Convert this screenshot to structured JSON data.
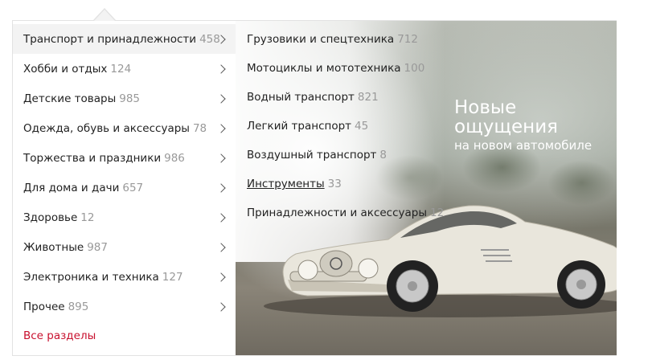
{
  "categories": [
    {
      "label": "Транспорт и принадлежности",
      "count": "458"
    },
    {
      "label": "Хобби и отдых",
      "count": "124"
    },
    {
      "label": "Детские товары",
      "count": "985"
    },
    {
      "label": "Одежда, обувь и аксессуары",
      "count": "78"
    },
    {
      "label": "Торжества и праздники",
      "count": "986"
    },
    {
      "label": "Для дома и дачи",
      "count": "657"
    },
    {
      "label": "Здоровье",
      "count": "12"
    },
    {
      "label": "Животные",
      "count": "987"
    },
    {
      "label": "Электроника и техника",
      "count": "127"
    },
    {
      "label": "Прочее",
      "count": "895"
    }
  ],
  "all_sections_label": "Все разделы",
  "subcategories": [
    {
      "label": "Грузовики и спецтехника",
      "count": "712"
    },
    {
      "label": "Мотоциклы и мототехника",
      "count": "100"
    },
    {
      "label": "Водный транспорт",
      "count": "821"
    },
    {
      "label": "Легкий транспорт",
      "count": "45"
    },
    {
      "label": "Воздушный транспорт",
      "count": "8"
    },
    {
      "label": "Инструменты",
      "count": "33"
    },
    {
      "label": "Принадлежности и аксессуары",
      "count": "12"
    }
  ],
  "promo": {
    "line1": "Новые",
    "line2": "ощущения",
    "line3": "на новом автомобиле"
  },
  "colors": {
    "accent": "#c8102e",
    "count": "#999999",
    "active_bg": "#f3f3f3"
  },
  "active_category_index": 0
}
